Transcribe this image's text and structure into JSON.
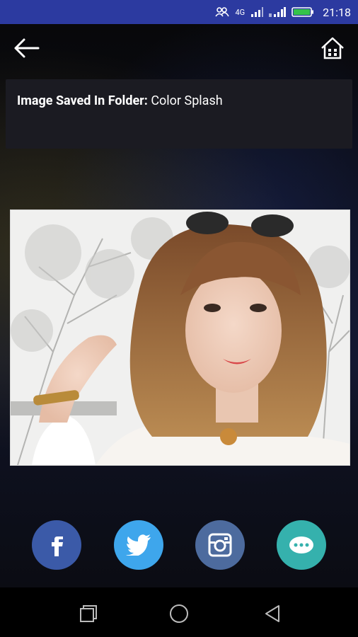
{
  "status_bar": {
    "network": "4G",
    "time": "21:18"
  },
  "info": {
    "label": "Image Saved In Folder:",
    "folder": "Color Splash"
  },
  "icons": {
    "back": "arrow-left",
    "home": "house",
    "share": [
      "facebook",
      "twitter",
      "instagram",
      "more-dots"
    ],
    "nav": [
      "recent-apps",
      "home-circle",
      "back-triangle"
    ]
  },
  "colors": {
    "status_bar": "#2c3aa0",
    "facebook": "#3b5aa8",
    "twitter": "#3ea6ec",
    "instagram": "#4d6b9e",
    "more": "#35b1ad"
  }
}
